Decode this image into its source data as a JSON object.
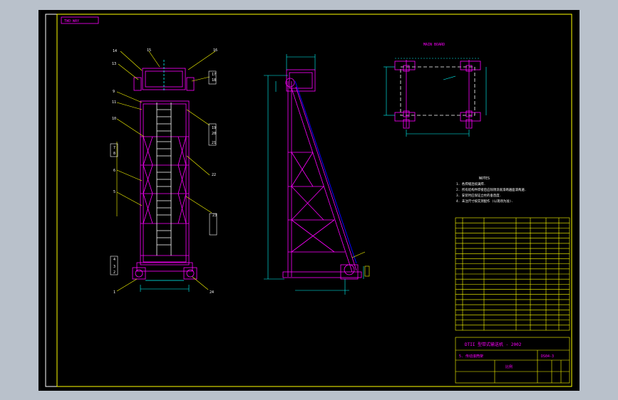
{
  "viewer": {
    "background": "#b9c1cb",
    "canvas_color": "#000000"
  },
  "drawing": {
    "stamp_label": "TWO-WAY",
    "plan_view_title": "MAIN BOARD",
    "notes_title": "NOTES",
    "notes": [
      "1. 各焊缝连续满焊.",
      "2. 所有结构件焊接后应除锈涂底漆两遍面漆两遍.",
      "3. 安装时应保证立柱的垂直度.",
      "4. 未注尺寸按实测配作 (以现场为准)."
    ],
    "title_main": "DTII 型带式输送机 - 2002",
    "title_sub": "5. 传动滚筒架",
    "drawing_no": "DS04-3",
    "scale_label": "比例",
    "colors": {
      "frame": "#ffffff",
      "structure": "#ff00ff",
      "dimension": "#00ffff",
      "leader": "#ffff00",
      "text": "#ff00ff",
      "label": "#ffffff"
    }
  },
  "balloons_left": [
    "14",
    "13",
    "9",
    "11",
    "10",
    "7",
    "8",
    "6",
    "5",
    "4",
    "3",
    "2",
    "1"
  ],
  "balloons_right": [
    "15",
    "16",
    "17",
    "18",
    "19",
    "20",
    "21",
    "22",
    "23",
    "24"
  ]
}
